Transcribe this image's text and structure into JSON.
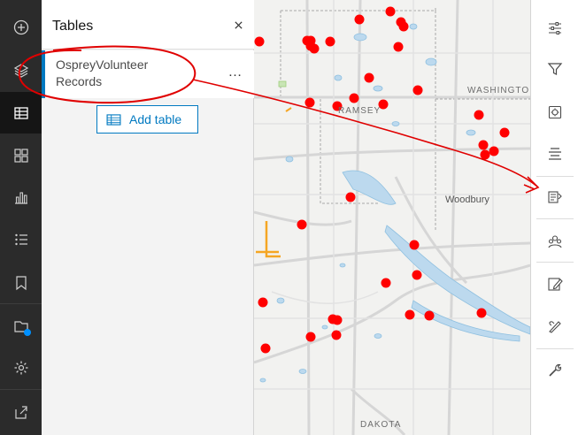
{
  "left_rail": {
    "items": [
      {
        "name": "add-icon"
      },
      {
        "name": "layers-icon"
      },
      {
        "name": "tables-icon"
      },
      {
        "name": "widgets-icon"
      },
      {
        "name": "charts-icon"
      },
      {
        "name": "legend-icon"
      },
      {
        "name": "bookmark-icon"
      },
      {
        "name": "basemap-icon"
      },
      {
        "name": "settings-icon"
      },
      {
        "name": "share-icon"
      }
    ]
  },
  "tables_panel": {
    "title": "Tables",
    "close_icon": "close-icon",
    "item_label": "OspreyVolunteer Records",
    "item_menu": "…",
    "add_table_label": "Add table"
  },
  "map": {
    "labels": {
      "washington": "WASHINGTO",
      "ramsey": "RAMSEY",
      "woodbury": "Woodbury",
      "dakota": "DAKOTA"
    },
    "point_color": "#ff0000",
    "annotation_color": "#e00000"
  },
  "right_rail": {
    "tools": [
      "properties-sliders-icon",
      "filter-icon",
      "effects-icon",
      "labels-icon",
      "pop-up-config-icon",
      "clustering-icon",
      "edit-icon",
      "sketch-icon",
      "utility-icon"
    ]
  },
  "colors": {
    "accent": "#0079c1",
    "rail_bg": "#2b2b2b"
  }
}
